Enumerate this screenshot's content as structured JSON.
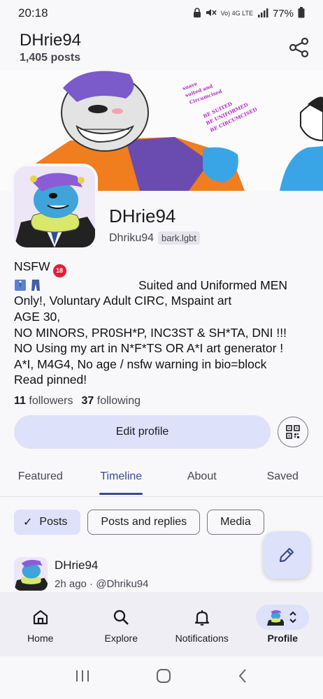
{
  "status_bar": {
    "time": "20:18",
    "network": "Vo) 4G LTE",
    "battery": "77%"
  },
  "header": {
    "title": "DHrie94",
    "subtitle": "1,405 posts"
  },
  "banner": {
    "text_lines": [
      "suave",
      "suited and",
      "Circumcised"
    ],
    "text_lines_2": [
      "BE SUITED",
      "BE UNIFORMED",
      "BE CIRCUMCISED"
    ]
  },
  "profile": {
    "display_name": "DHrie94",
    "handle": "Dhriku94",
    "instance": "bark.lgbt",
    "bio": {
      "line1": "NSFW",
      "badge": "18",
      "line2": "Suited and Uniformed MEN",
      "line3": "Only!, Voluntary Adult CIRC, Mspaint art",
      "line4": "AGE 30,",
      "line5": "NO MINORS, PR0SH*P, INC3ST & SH*TA, DNI !!!",
      "line6": "NO Using my art in N*F*TS OR A*I art generator !",
      "line7": "A*I, M4G4, No age / nsfw warning in bio=block",
      "line8": "Read pinned!"
    },
    "followers_count": "11",
    "followers_label": "followers",
    "following_count": "37",
    "following_label": "following",
    "edit_button": "Edit profile"
  },
  "tabs": [
    {
      "label": "Featured",
      "active": false
    },
    {
      "label": "Timeline",
      "active": true
    },
    {
      "label": "About",
      "active": false
    },
    {
      "label": "Saved",
      "active": false
    }
  ],
  "filters": [
    {
      "label": "Posts",
      "selected": true
    },
    {
      "label": "Posts and replies",
      "selected": false
    },
    {
      "label": "Media",
      "selected": false
    }
  ],
  "post_preview": {
    "author": "DHrie94",
    "time": "2h ago",
    "handle": "@Dhriku94"
  },
  "bottom_nav": [
    {
      "label": "Home",
      "icon": "home-icon"
    },
    {
      "label": "Explore",
      "icon": "search-icon"
    },
    {
      "label": "Notifications",
      "icon": "bell-icon"
    },
    {
      "label": "Profile",
      "icon": "avatar-switch-icon",
      "active": true
    }
  ],
  "colors": {
    "accent": "#3b4a8c",
    "accent_container": "#dde1f9",
    "badge_red": "#e0203a"
  }
}
